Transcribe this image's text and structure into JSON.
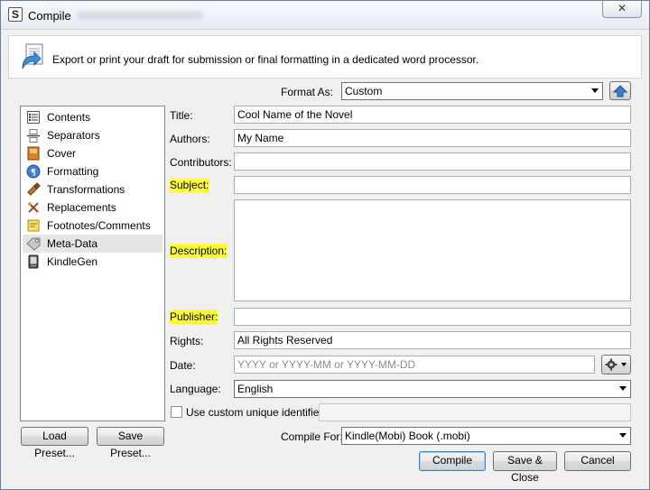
{
  "window": {
    "title": "Compile"
  },
  "header": {
    "description": "Export or print your draft for submission or final formatting in a dedicated word processor."
  },
  "format_as": {
    "label": "Format As:",
    "value": "Custom"
  },
  "sidebar": {
    "items": [
      {
        "label": "Contents",
        "icon": "contents-icon"
      },
      {
        "label": "Separators",
        "icon": "separators-icon"
      },
      {
        "label": "Cover",
        "icon": "cover-icon"
      },
      {
        "label": "Formatting",
        "icon": "formatting-icon"
      },
      {
        "label": "Transformations",
        "icon": "transformations-icon"
      },
      {
        "label": "Replacements",
        "icon": "replacements-icon"
      },
      {
        "label": "Footnotes/Comments",
        "icon": "footnotes-icon"
      },
      {
        "label": "Meta-Data",
        "icon": "tag-icon",
        "selected": true
      },
      {
        "label": "KindleGen",
        "icon": "kindle-icon"
      }
    ]
  },
  "form": {
    "title": {
      "label": "Title:",
      "value": "Cool Name of the Novel"
    },
    "authors": {
      "label": "Authors:",
      "value": "My Name"
    },
    "contributors": {
      "label": "Contributors:",
      "value": ""
    },
    "subject": {
      "label": "Subject:",
      "value": ""
    },
    "description": {
      "label": "Description:",
      "value": ""
    },
    "publisher": {
      "label": "Publisher:",
      "value": ""
    },
    "rights": {
      "label": "Rights:",
      "value": "All Rights Reserved"
    },
    "date": {
      "label": "Date:",
      "placeholder": "YYYY or YYYY-MM or YYYY-MM-DD"
    },
    "language": {
      "label": "Language:",
      "value": "English"
    },
    "custom_identifier": {
      "label": "Use custom unique identifier",
      "checked": false,
      "value": ""
    }
  },
  "footer": {
    "load_preset": "Load Preset...",
    "save_preset": "Save Preset...",
    "compile_for": {
      "label": "Compile For:",
      "value": "Kindle(Mobi) Book (.mobi)"
    },
    "compile": "Compile",
    "save_close": "Save & Close",
    "cancel": "Cancel"
  },
  "colors": {
    "highlight": "#ffff3a",
    "selected_row": "#e6e6e6",
    "default_button_border": "#3c7fb1"
  }
}
